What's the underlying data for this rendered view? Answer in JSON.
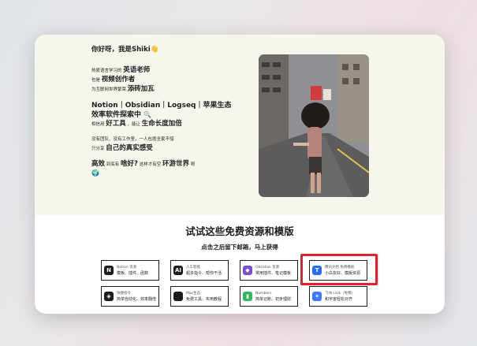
{
  "hero": {
    "greeting": "你好呀，我是Shiki👋",
    "line1_pre": "热爱语言学习的",
    "line1_em": "英语老师",
    "line2_pre": "也是",
    "line2_em": "视频创作者",
    "line3_pre": "为互联网世界繁荣",
    "line3_em": "添砖加瓦",
    "tools_line": "Notion｜Obsidian｜Logseq｜苹果生态",
    "explorer": "效率软件探索中",
    "line4_pre": "相信用",
    "line4_em": "好工具",
    "line4_mid": "，能让",
    "line4_em2": "生命长度加倍",
    "line5": "没有团队、没有工作室，一人包揽全家不惜",
    "line6_pre": "只分享",
    "line6_em": "自己的真实感受",
    "line7_em": "高效",
    "line7_mid": "到底有",
    "line7_em2": "啥好?",
    "line7_mid2": "这样才有空",
    "line7_em3": "环游世界",
    "line7_end": "呀"
  },
  "resources": {
    "title": "试试这些免费资源和模版",
    "subtitle": "点击之后留下邮箱，马上获得",
    "items": [
      {
        "name": "Notion 资源",
        "desc": "模板、插件、函数",
        "icon": "notion-icon",
        "color": "#1d1d1f",
        "glyph": "N"
      },
      {
        "name": "人工智能",
        "desc": "超多指令、帮你干活",
        "icon": "ai-icon",
        "color": "#1d1d1f",
        "glyph": "AI"
      },
      {
        "name": "Obsidian 资源",
        "desc": "常用插件、笔记模板",
        "icon": "obsidian-icon",
        "color": "#7a4fcf",
        "glyph": "◆"
      },
      {
        "name": "腾讯文档 免费模板",
        "desc": "小白友好、模版资源",
        "icon": "tencent-docs-icon",
        "color": "#2a6df4",
        "glyph": "T"
      },
      {
        "name": "快捷指令",
        "desc": "简单自动化、效率翻倍",
        "icon": "shortcuts-icon",
        "color": "#1d1d1f",
        "glyph": "◈"
      },
      {
        "name": "Mac生态",
        "desc": "免费工具、实用教程",
        "icon": "apple-icon",
        "color": "#1d1d1f",
        "glyph": ""
      },
      {
        "name": "Numbers",
        "desc": "简单记账、初步理财",
        "icon": "numbers-icon",
        "color": "#2fb85c",
        "glyph": "▮"
      },
      {
        "name": "飞书 Lark（免费）",
        "desc": "和宇宙轻松对齐",
        "icon": "feishu-icon",
        "color": "#3a7bff",
        "glyph": "✦"
      }
    ]
  }
}
